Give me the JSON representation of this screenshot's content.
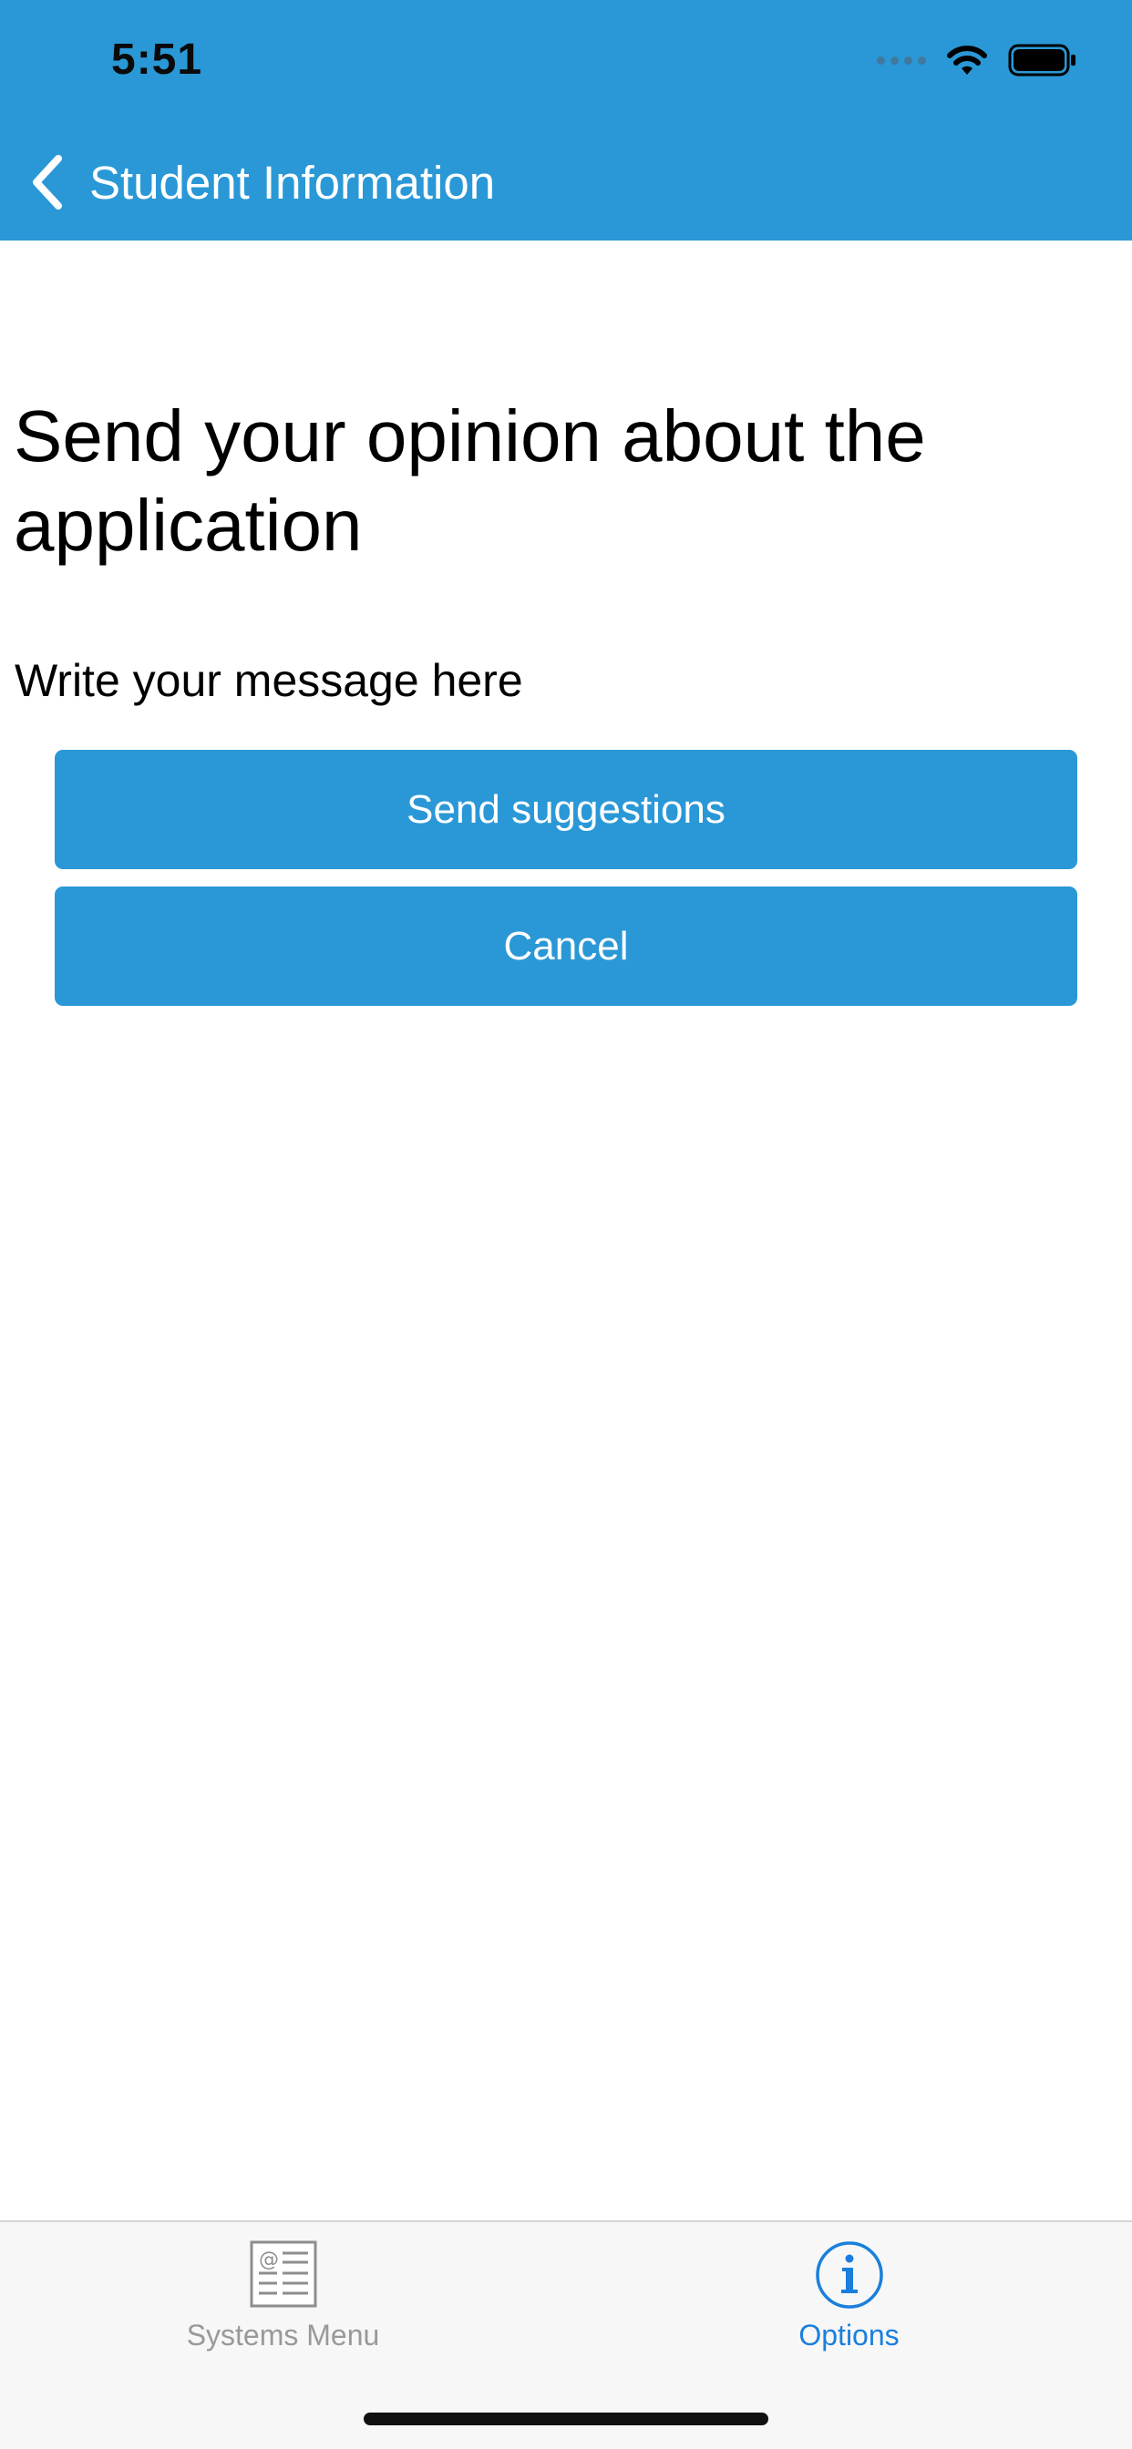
{
  "status_bar": {
    "time": "5:51"
  },
  "nav": {
    "back_label": "Student Information"
  },
  "content": {
    "title": "Send your opinion about the application",
    "message_hint": "Write your message here",
    "send_label": "Send suggestions",
    "cancel_label": "Cancel"
  },
  "tab_bar": {
    "items": [
      {
        "label": "Systems Menu",
        "icon": "systems-menu-icon",
        "selected": false
      },
      {
        "label": "Options",
        "icon": "info-icon",
        "selected": true
      }
    ]
  },
  "colors": {
    "accent": "#2a98d6",
    "tab_selected": "#1a7fdc",
    "tab_unselected": "#999999"
  }
}
